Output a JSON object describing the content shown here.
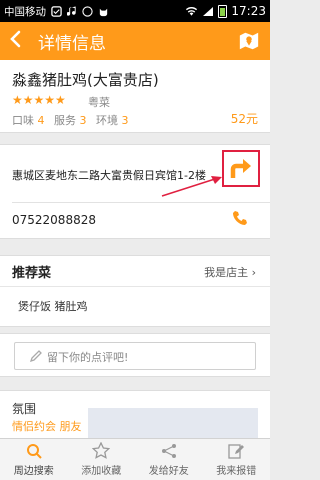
{
  "status_bar": {
    "carrier": "中国移动",
    "time": "17:23"
  },
  "header": {
    "title": "详情信息",
    "back_icon": "back-arrow-icon",
    "map_icon": "map-icon"
  },
  "shop": {
    "name": "淼鑫猪肚鸡(大富贵店)",
    "rating": 5,
    "stars": "★★★★★",
    "cuisine": "粤菜",
    "scores": [
      {
        "label": "口味",
        "value": "4"
      },
      {
        "label": "服务",
        "value": "3"
      },
      {
        "label": "环境",
        "value": "3"
      }
    ],
    "price": "52元"
  },
  "contact": {
    "address": "惠城区麦地东二路大富贵假日宾馆1-2楼",
    "phone": "07522088828"
  },
  "recommend": {
    "title": "推荐菜",
    "owner_link": "我是店主 ›",
    "dishes": "煲仔饭 猪肚鸡"
  },
  "comment": {
    "placeholder": "留下你的点评吧!"
  },
  "atmosphere": {
    "title": "氛围",
    "value": "情侣约会 朋友"
  },
  "tabs": [
    {
      "label": "周边搜索",
      "icon": "search-icon"
    },
    {
      "label": "添加收藏",
      "icon": "star-icon"
    },
    {
      "label": "发给好友",
      "icon": "share-icon"
    },
    {
      "label": "我来报错",
      "icon": "edit-icon"
    }
  ],
  "colors": {
    "accent": "#ff9a1a",
    "highlight": "#e02040"
  }
}
